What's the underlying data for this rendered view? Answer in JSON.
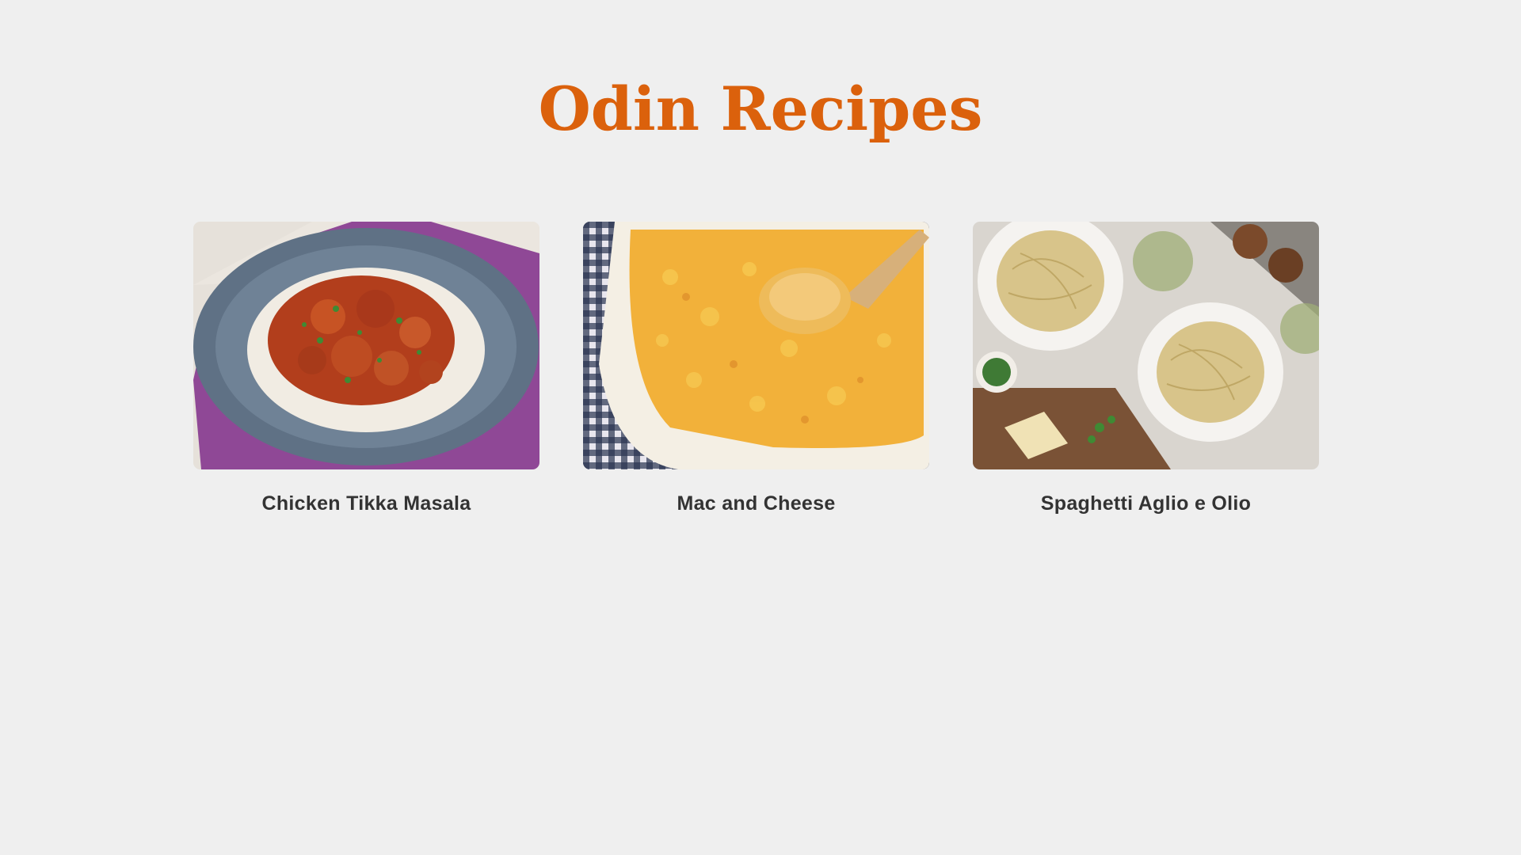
{
  "page": {
    "title": "Odin Recipes",
    "title_color": "#db610c",
    "background": "#efefef"
  },
  "recipes": [
    {
      "name": "Chicken Tikka Masala",
      "image": "chicken-tikka-masala-photo"
    },
    {
      "name": "Mac and Cheese",
      "image": "mac-and-cheese-photo"
    },
    {
      "name": "Spaghetti Aglio e Olio",
      "image": "spaghetti-aglio-e-olio-photo"
    }
  ]
}
